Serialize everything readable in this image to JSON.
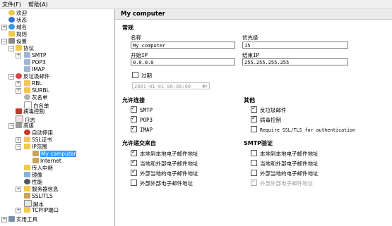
{
  "menu": {
    "file": "文件(F)",
    "help": "帮助(A)"
  },
  "tree": {
    "welcome": "欢迎",
    "status": "状态",
    "domains": "域名",
    "rules": "规则",
    "settings": "设置",
    "protocols": "协议",
    "smtp": "SMTP",
    "pop3": "POP3",
    "imap": "IMAP",
    "antispam": "反垃圾邮件",
    "rbl": "RBL",
    "surbl": "SURBL",
    "greylist": "灰名单",
    "whitelist": "白名单",
    "antivirus": "病毒控制",
    "logging": "日志",
    "advanced": "高级",
    "autoban": "自动停用",
    "ssl_certs": "SSL证书",
    "ip_ranges": "IP范围",
    "my_computer": "My computer",
    "internet": "Internet",
    "incoming_relays": "传入中继",
    "mirror": "镜像",
    "performance": "性能",
    "server_messages": "服务器信息",
    "ssl_tls": "SSL/TLS",
    "scripts": "脚本",
    "tcp_ports": "TCP/IP端口",
    "utilities": "实用工具"
  },
  "panel": {
    "title": "My computer",
    "general": "常规",
    "name_label": "名称",
    "name_value": "My computer",
    "priority_label": "优先级",
    "priority_value": "15",
    "start_ip_label": "开始IP",
    "start_ip_value": "0.0.0.0",
    "end_ip_label": "结束IP",
    "end_ip_value": "255.255.255.255",
    "expires_label": "过期",
    "expires_value": "2001-01-01 00:00:00",
    "allow_conn": "允许连接",
    "other": "其他",
    "smtp": "SMTP",
    "pop3": "POP3",
    "imap": "IMAP",
    "antispam": "反垃圾邮件",
    "antivirus": "病毒控制",
    "require_ssl": "Require SSL/TLS for authentication",
    "allow_delivery": "允许递交来自",
    "smtp_auth": "SMTP验证",
    "d_local_local": "本地到本地电子邮件地址",
    "d_local_ext": "当地和外部电子邮件地址",
    "d_ext_local": "外部当地的电子邮件地址",
    "d_ext_ext": "外部外部电子邮件地址",
    "a_local_local": "本地到本地电子邮件地址",
    "a_local_ext": "当地和外部电子邮件地址",
    "a_ext_local": "外部当地的电子邮件地址",
    "a_ext_ext": "外部外部电子邮件地址"
  },
  "colors": {
    "selection": "#3399ff",
    "folder": "#f2c94c",
    "title_bg": "#eaeaea"
  }
}
